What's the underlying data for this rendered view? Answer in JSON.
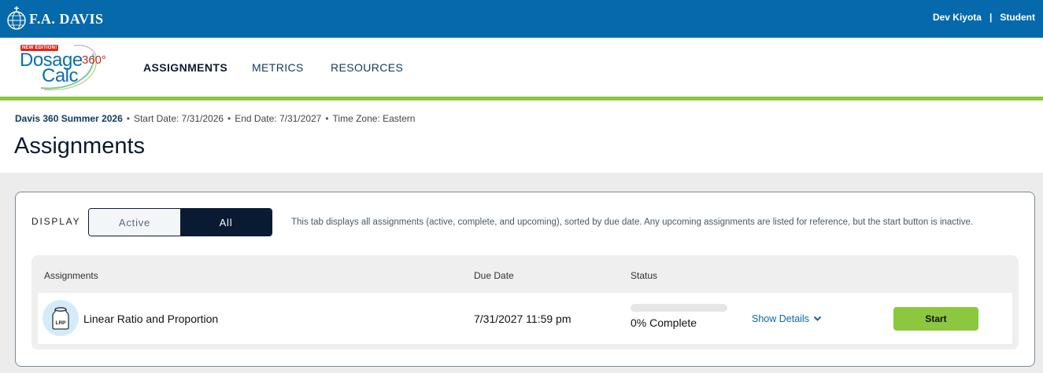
{
  "brand": {
    "name": "F.A. DAVIS"
  },
  "user": {
    "name": "Dev Kiyota",
    "separator": "|",
    "role": "Student"
  },
  "logo": {
    "badge": "NEW EDITION!",
    "line1": "Dosage",
    "line2": "Calc",
    "suffix": "360°"
  },
  "nav": {
    "tabs": [
      {
        "label": "ASSIGNMENTS",
        "active": true
      },
      {
        "label": "METRICS",
        "active": false
      },
      {
        "label": "RESOURCES",
        "active": false
      }
    ]
  },
  "course": {
    "name": "Davis 360 Summer 2026",
    "bullet": "•",
    "start": "Start Date: 7/31/2026",
    "end": "End Date: 7/31/2027",
    "timezone": "Time Zone: Eastern"
  },
  "page": {
    "title": "Assignments"
  },
  "display": {
    "label": "DISPLAY",
    "options": [
      "Active",
      "All"
    ],
    "selected": "All",
    "description": "This tab displays all assignments (active, complete, and upcoming), sorted by due date. Any upcoming assignments are listed for reference, but the start button is inactive."
  },
  "table": {
    "columns": [
      "Assignments",
      "Due Date",
      "Status"
    ],
    "rows": [
      {
        "icon_label": "LRP",
        "icon": "vial-icon",
        "name": "Linear Ratio and Proportion",
        "due": "7/31/2027 11:59 pm",
        "progress_percent": 0,
        "status": "0% Complete",
        "details_label": "Show Details",
        "action_label": "Start"
      }
    ]
  },
  "colors": {
    "topbar": "#0569ac",
    "accent_green": "#8dc63f",
    "navy": "#0b1a33",
    "link": "#0569ac"
  }
}
